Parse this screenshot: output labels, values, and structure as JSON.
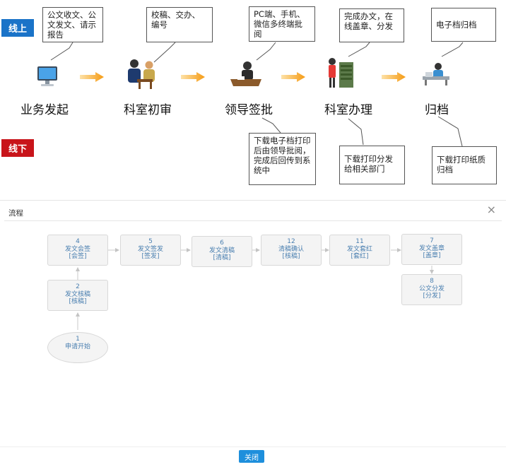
{
  "tags": {
    "online": "线上",
    "offline": "线下"
  },
  "stages": [
    {
      "label": "业务发起",
      "icon": "computer-icon",
      "online_note": "公文收文、公文发文、请示报告"
    },
    {
      "label": "科室初审",
      "icon": "staff-review-icon",
      "online_note": "校稿、交办、编号"
    },
    {
      "label": "领导签批",
      "icon": "leader-desk-icon",
      "online_note": "PC端、手机、微信多终端批阅",
      "offline_note": "下载电子档打印后由领导批阅，完成后回传到系统中"
    },
    {
      "label": "科室办理",
      "icon": "server-rack-icon",
      "online_note": "完成办文，在线盖章、分发",
      "offline_note": "下载打印分发给相关部门"
    },
    {
      "label": "归档",
      "icon": "archive-desk-icon",
      "online_note": "电子档归档",
      "offline_note": "下载打印纸质归档"
    }
  ],
  "modal": {
    "title": "流程",
    "close_icon": "×",
    "close_button": "关闭",
    "nodes": [
      {
        "id": "1",
        "name": "申请开始",
        "tag": ""
      },
      {
        "id": "2",
        "name": "发文核稿",
        "tag": "[核稿]"
      },
      {
        "id": "4",
        "name": "发文会签",
        "tag": "[会签]"
      },
      {
        "id": "5",
        "name": "发文签发",
        "tag": "[签发]"
      },
      {
        "id": "6",
        "name": "发文清稿",
        "tag": "[清稿]"
      },
      {
        "id": "12",
        "name": "清稿确认",
        "tag": "[核稿]"
      },
      {
        "id": "11",
        "name": "发文套红",
        "tag": "[套红]"
      },
      {
        "id": "7",
        "name": "发文盖章",
        "tag": "[盖章]"
      },
      {
        "id": "8",
        "name": "公文分发",
        "tag": "[分发]"
      }
    ]
  },
  "colors": {
    "online": "#1a73c8",
    "offline": "#c8141a",
    "arrow": "#f59a12",
    "node_text": "#4a7fb0",
    "button": "#1e8fdc"
  }
}
